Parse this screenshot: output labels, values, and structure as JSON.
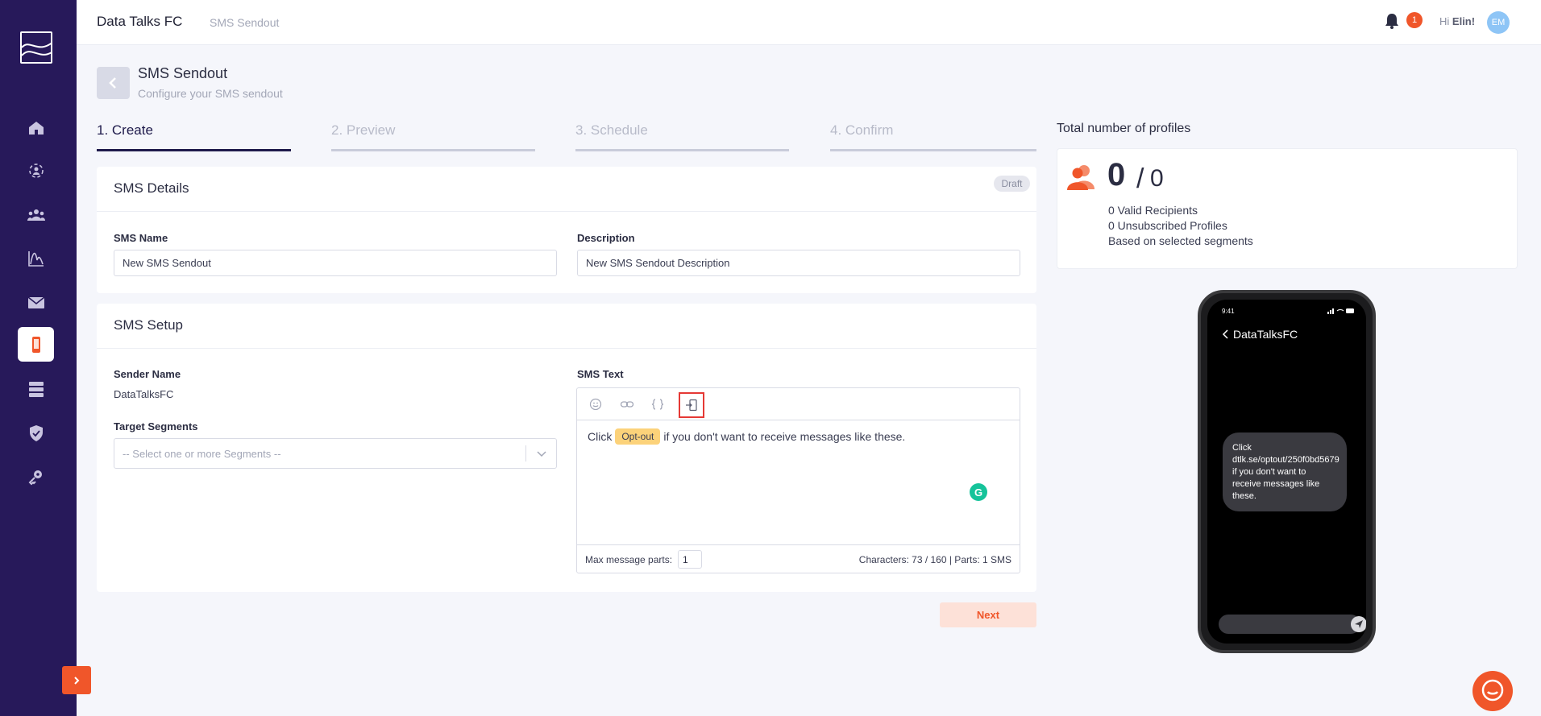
{
  "header": {
    "app_title": "Data Talks FC",
    "breadcrumb": "SMS Sendout",
    "notification_count": "1",
    "greeting_prefix": "Hi",
    "user_name": "Elin!",
    "avatar_initials": "EM"
  },
  "page": {
    "title": "SMS Sendout",
    "subtitle": "Configure your SMS sendout"
  },
  "steps": [
    {
      "label": "1. Create",
      "active": true
    },
    {
      "label": "2. Preview",
      "active": false
    },
    {
      "label": "3. Schedule",
      "active": false
    },
    {
      "label": "4. Confirm",
      "active": false
    }
  ],
  "details": {
    "title": "SMS Details",
    "status_badge": "Draft",
    "name_label": "SMS Name",
    "name_value": "New SMS Sendout",
    "description_label": "Description",
    "description_value": "New SMS Sendout Description"
  },
  "setup": {
    "title": "SMS Setup",
    "sender_label": "Sender Name",
    "sender_value": "DataTalksFC",
    "segments_label": "Target Segments",
    "segments_placeholder": "-- Select one or more Segments --",
    "sms_text_label": "SMS Text",
    "message_before": "Click",
    "optout_chip": "Opt-out",
    "message_after": "if you don't want to receive messages like these.",
    "max_parts_label": "Max message parts:",
    "max_parts_value": "1",
    "char_count": "Characters: 73 / 160 | Parts: 1 SMS"
  },
  "actions": {
    "next_label": "Next"
  },
  "profiles": {
    "title": "Total number of profiles",
    "count": "0",
    "total": "0",
    "valid_recipients": "0 Valid Recipients",
    "unsubscribed": "0 Unsubscribed Profiles",
    "based_on": "Based on selected segments"
  },
  "phone_preview": {
    "time": "9:41",
    "sender": "DataTalksFC",
    "bubble_lines": [
      "Click",
      "dtlk.se/optout/250f0bd5679",
      "if you don't want to",
      "receive messages like",
      "these."
    ]
  },
  "colors": {
    "sidebar_bg": "#27195a",
    "accent_orange": "#f0562a",
    "optout_chip": "#fcd27a",
    "active_step": "#1e1a4b"
  },
  "icons": {
    "nav": [
      "home-icon",
      "segments-icon",
      "audience-icon",
      "analytics-icon",
      "email-icon",
      "sms-icon",
      "database-icon",
      "shield-icon",
      "key-icon"
    ],
    "toolbar": [
      "emoji-icon",
      "link-icon",
      "variable-icon",
      "optout-insert-icon"
    ]
  }
}
